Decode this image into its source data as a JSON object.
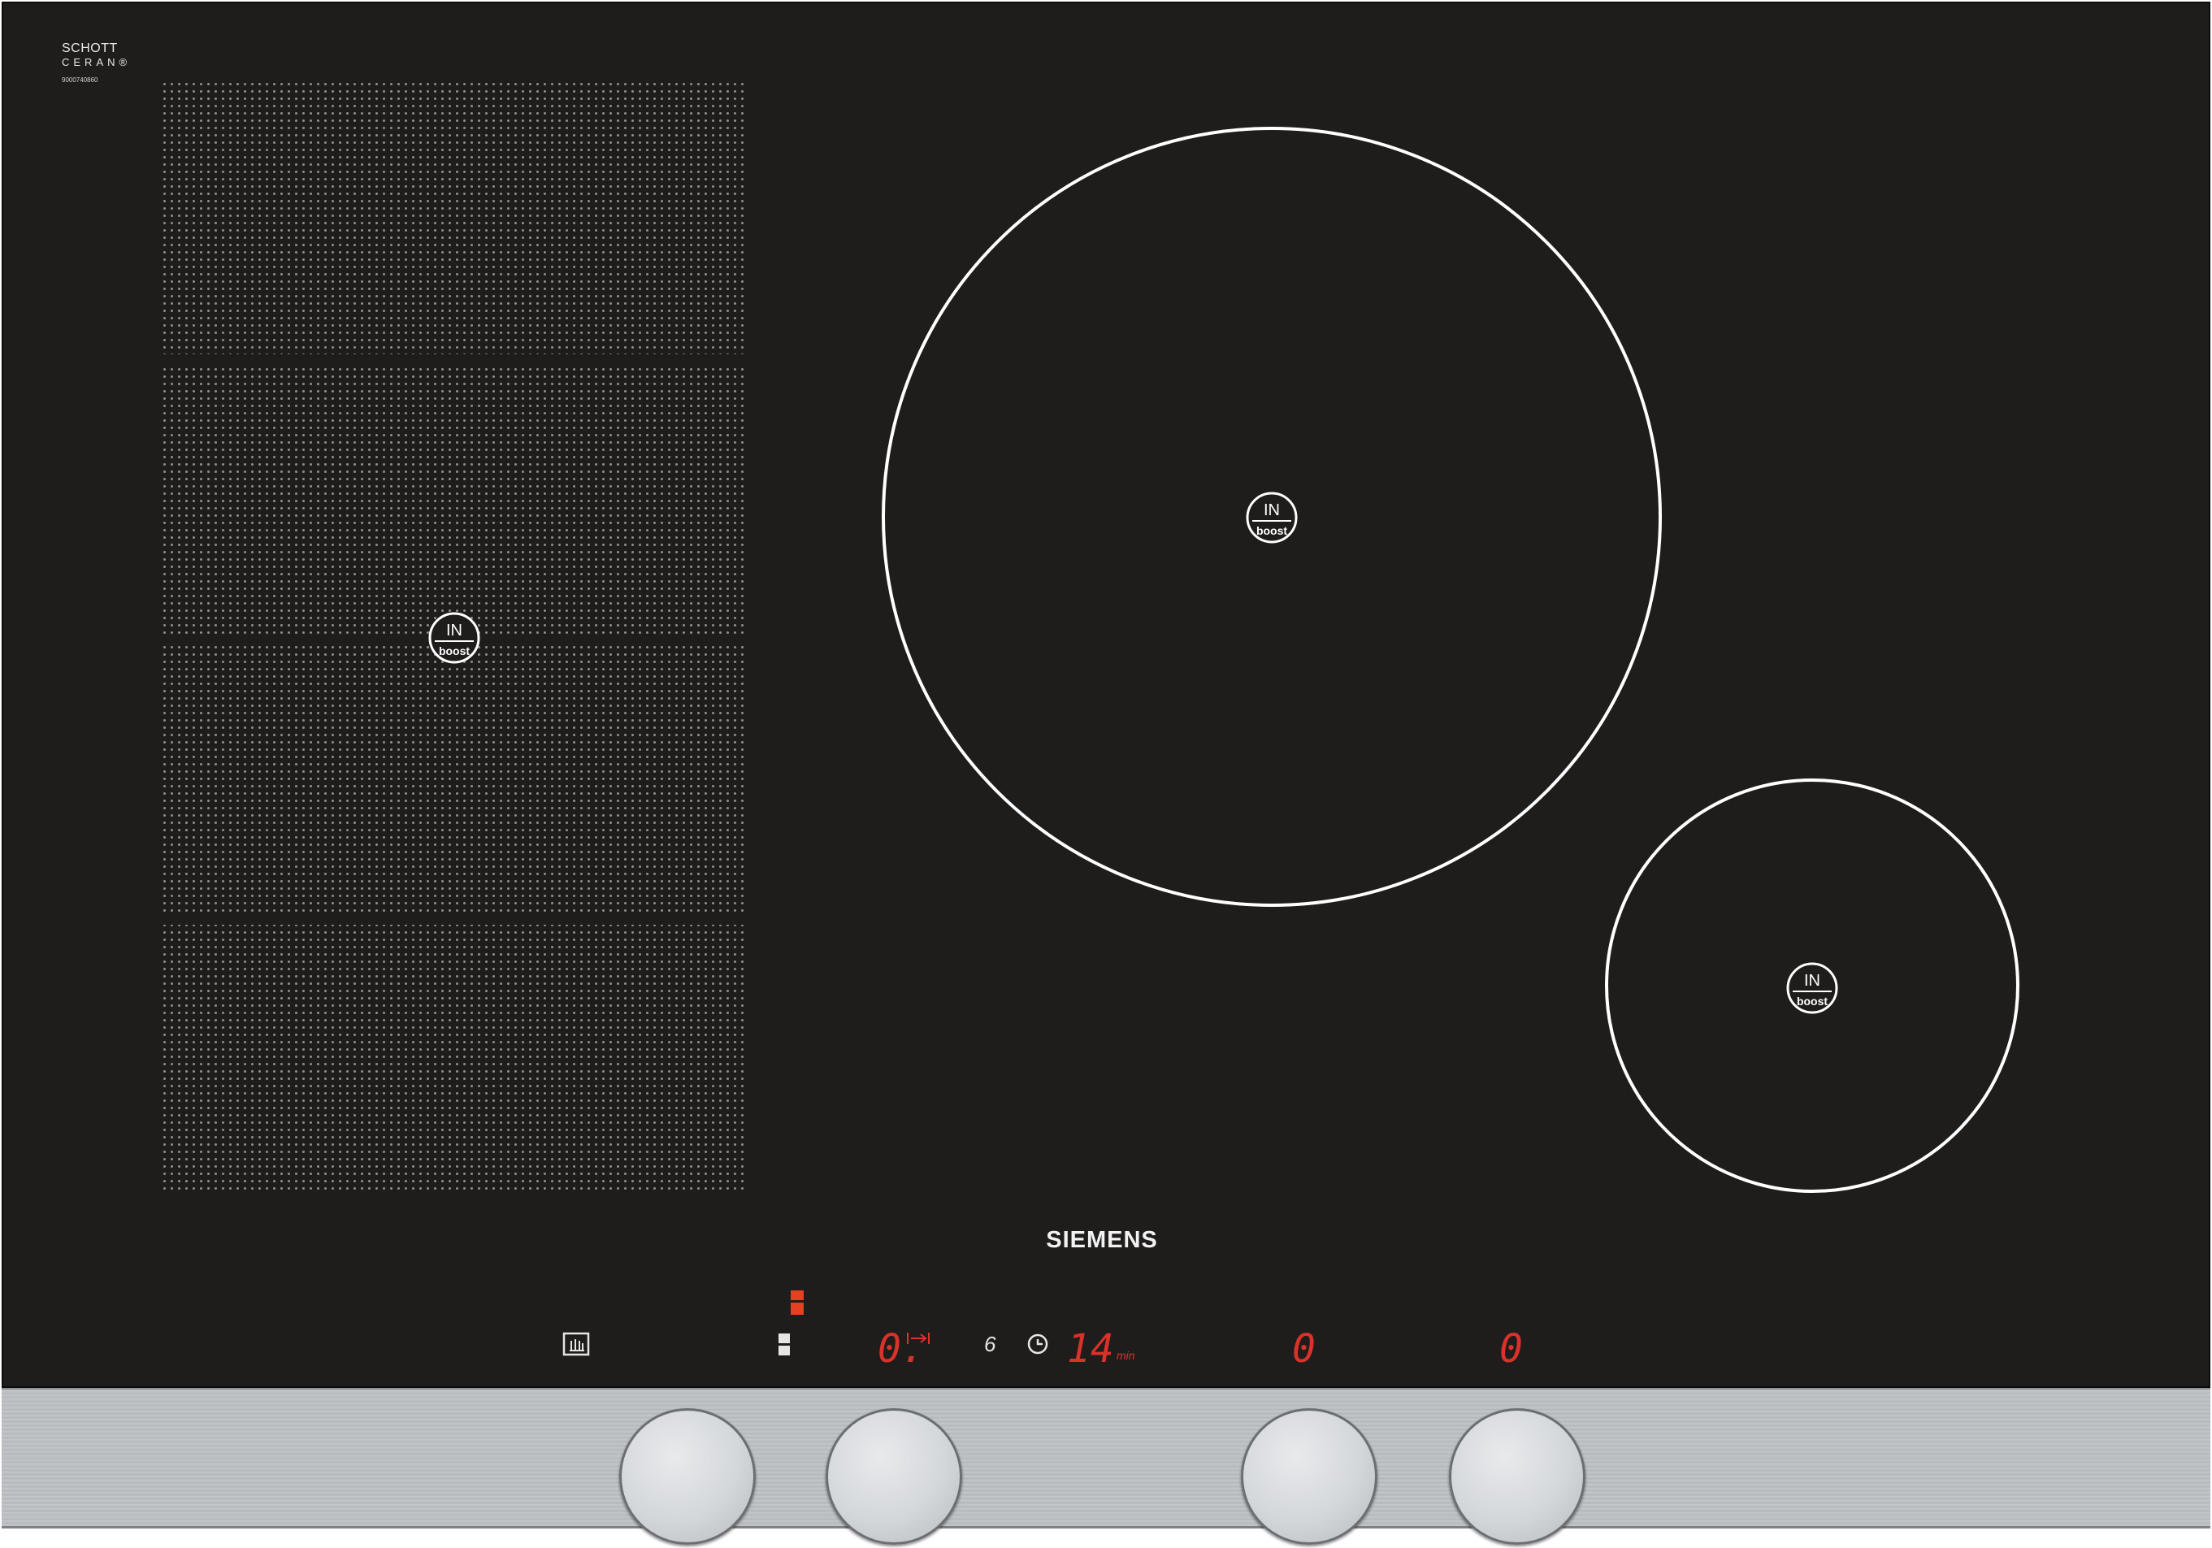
{
  "glass_label": {
    "line1": "SCHOTT",
    "line2": "CERAN®",
    "serial": "9000740860"
  },
  "brand": "SIEMENS",
  "zone_badge": {
    "top": "IN",
    "bottom": "boost"
  },
  "control_panel": {
    "zone_level_display": "0.",
    "power_level_small": "6",
    "timer_value": "14",
    "timer_unit": "min",
    "zone3_display": "0",
    "zone4_display": "0"
  },
  "colors": {
    "glass": "#1f1d1c",
    "display_red": "#d9322a",
    "indicator_orange": "#e5401f",
    "steel": "#bfc2c5",
    "knob": "#d6d9dc"
  },
  "icons": [
    "zone-link-icon",
    "clock-icon",
    "child-lock-icon",
    "flex-zone-indicator-icon"
  ]
}
